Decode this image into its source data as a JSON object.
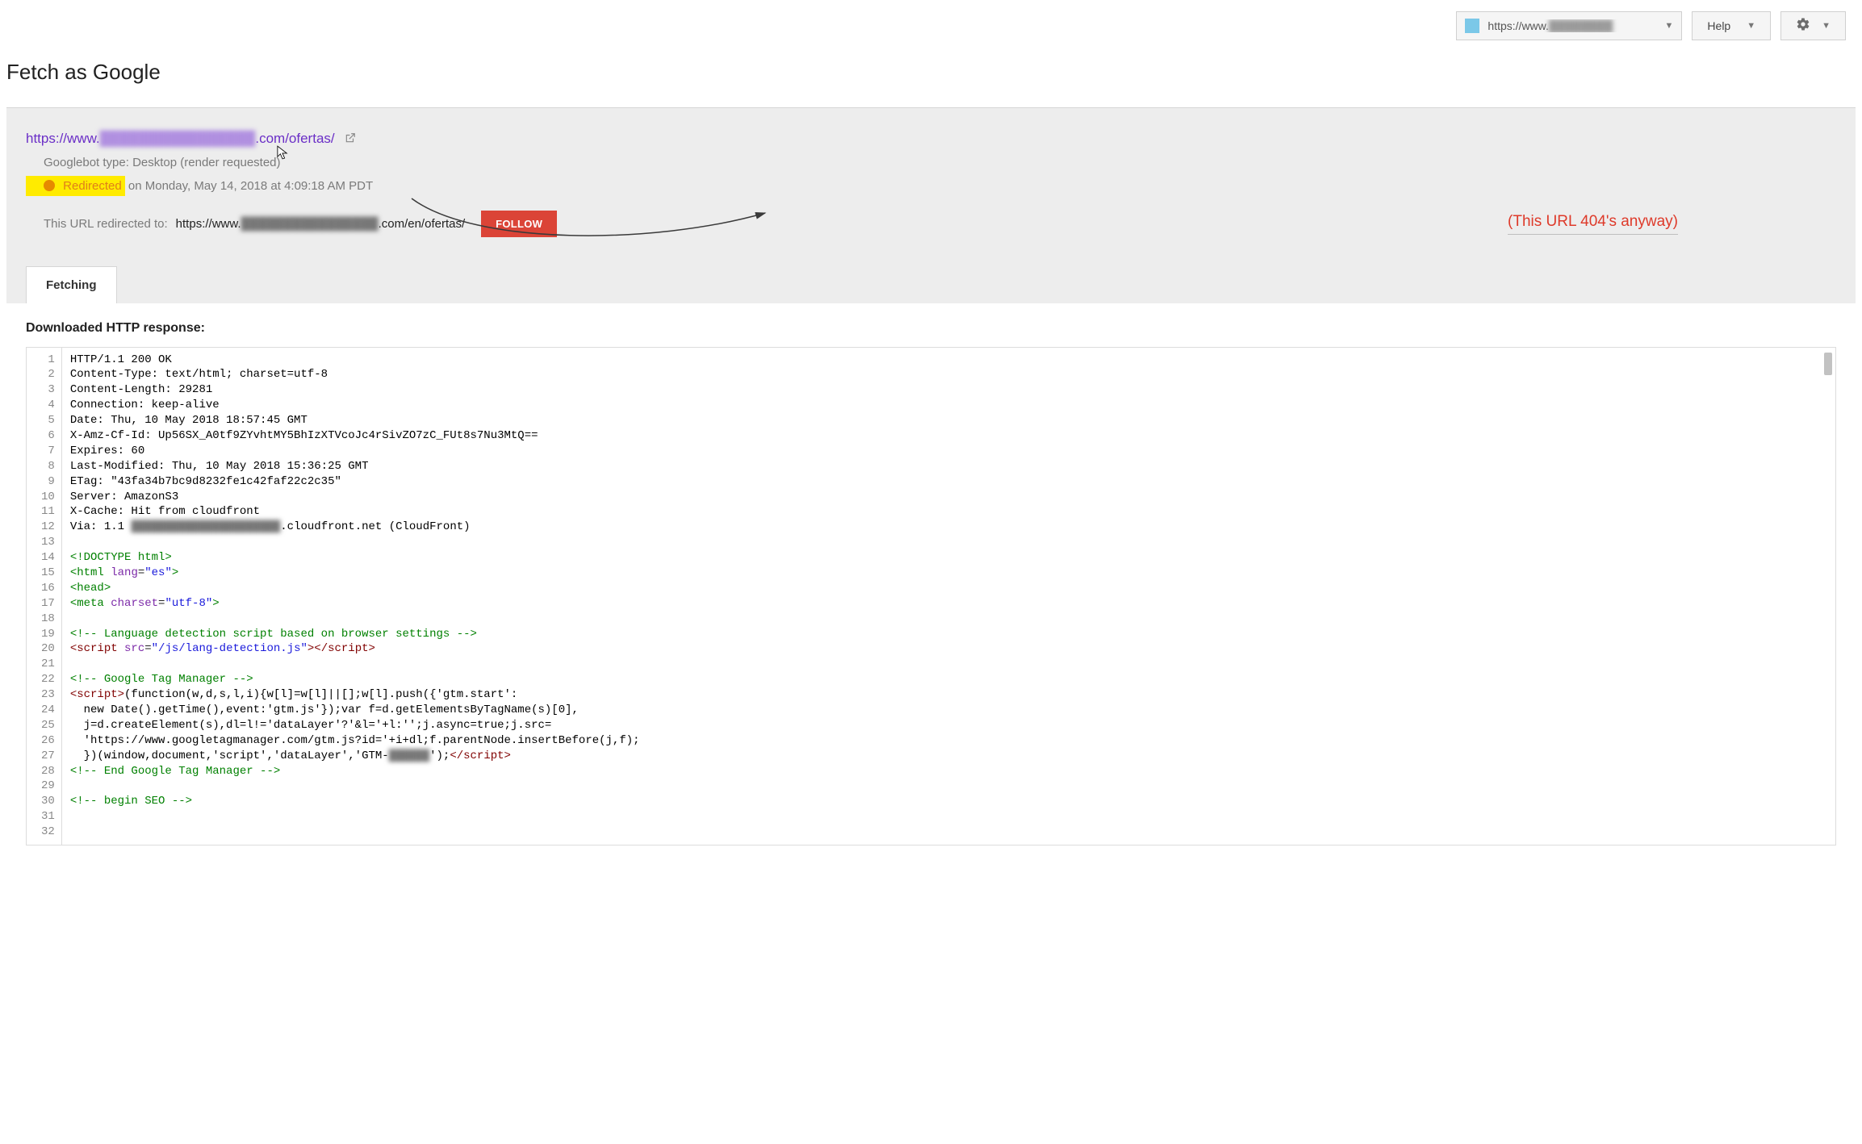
{
  "toolbar": {
    "site_url_prefix": "https://www.",
    "site_url_blur": "████████",
    "help_label": "Help"
  },
  "page_title": "Fetch as Google",
  "panel": {
    "url_prefix": "https://www.",
    "url_blur": "████████████████",
    "url_suffix": ".com/ofertas/",
    "googlebot_type": "Googlebot type: Desktop (render requested)",
    "status_word": "Redirected",
    "status_rest": " on Monday, May 14, 2018 at 4:09:18 AM PDT",
    "redirect_label": "This URL redirected to:",
    "redirect_prefix": "https://www.",
    "redirect_blur": "████████████████",
    "redirect_suffix": ".com/en/ofertas/",
    "follow_label": "FOLLOW",
    "annotation": "(This URL 404's anyway)",
    "tab_label": "Fetching"
  },
  "response": {
    "heading": "Downloaded HTTP response:",
    "lines": [
      {
        "n": 1,
        "t": "plain",
        "s": "HTTP/1.1 200 OK"
      },
      {
        "n": 2,
        "t": "plain",
        "s": "Content-Type: text/html; charset=utf-8"
      },
      {
        "n": 3,
        "t": "plain",
        "s": "Content-Length: 29281"
      },
      {
        "n": 4,
        "t": "plain",
        "s": "Connection: keep-alive"
      },
      {
        "n": 5,
        "t": "plain",
        "s": "Date: Thu, 10 May 2018 18:57:45 GMT"
      },
      {
        "n": 6,
        "t": "plain",
        "s": "X-Amz-Cf-Id: Up56SX_A0tf9ZYvhtMY5BhIzXTVcoJc4rSivZO7zC_FUt8s7Nu3MtQ=="
      },
      {
        "n": 7,
        "t": "plain",
        "s": "Expires: 60"
      },
      {
        "n": 8,
        "t": "plain",
        "s": "Last-Modified: Thu, 10 May 2018 15:36:25 GMT"
      },
      {
        "n": 9,
        "t": "plain",
        "s": "ETag: \"43fa34b7bc9d8232fe1c42faf22c2c35\""
      },
      {
        "n": 10,
        "t": "plain",
        "s": "Server: AmazonS3"
      },
      {
        "n": 11,
        "t": "plain",
        "s": "X-Cache: Hit from cloudfront"
      },
      {
        "n": 12,
        "t": "via",
        "prefix": "Via: 1.1 ",
        "blur": "██████████████████████",
        "suffix": ".cloudfront.net (CloudFront)"
      },
      {
        "n": 13,
        "t": "plain",
        "s": ""
      },
      {
        "n": 14,
        "t": "tag",
        "s": "<!DOCTYPE html>"
      },
      {
        "n": 15,
        "t": "html",
        "raw": "<html lang=\"es\">"
      },
      {
        "n": 16,
        "t": "tag",
        "s": "<head>"
      },
      {
        "n": 17,
        "t": "html",
        "raw": "<meta charset=\"utf-8\">"
      },
      {
        "n": 18,
        "t": "plain",
        "s": ""
      },
      {
        "n": 19,
        "t": "comment",
        "s": "<!-- Language detection script based on browser settings -->"
      },
      {
        "n": 20,
        "t": "html",
        "raw": "<script src=\"/js/lang-detection.js\"></script>"
      },
      {
        "n": 21,
        "t": "plain",
        "s": ""
      },
      {
        "n": 22,
        "t": "comment",
        "s": "<!-- Google Tag Manager -->"
      },
      {
        "n": 23,
        "t": "mixed",
        "parts": [
          {
            "c": "t-tag-script",
            "s": "<script>"
          },
          {
            "c": "t-plain",
            "s": "(function(w,d,s,l,i){w[l]=w[l]||[];w[l].push({'gtm.start':"
          }
        ]
      },
      {
        "n": 24,
        "t": "plain",
        "s": "  new Date().getTime(),event:'gtm.js'});var f=d.getElementsByTagName(s)[0],"
      },
      {
        "n": 25,
        "t": "plain",
        "s": "  j=d.createElement(s),dl=l!='dataLayer'?'&l='+l:'';j.async=true;j.src="
      },
      {
        "n": 26,
        "t": "plain",
        "s": "  'https://www.googletagmanager.com/gtm.js?id='+i+dl;f.parentNode.insertBefore(j,f);"
      },
      {
        "n": 27,
        "t": "gtm",
        "prefix": "  })(window,document,'script','dataLayer','GTM-",
        "blur": "██████",
        "suffix": "');",
        "close": "</script>"
      },
      {
        "n": 28,
        "t": "comment",
        "s": "<!-- End Google Tag Manager -->"
      },
      {
        "n": 29,
        "t": "plain",
        "s": ""
      },
      {
        "n": 30,
        "t": "comment",
        "s": "<!-- begin SEO -->"
      },
      {
        "n": 31,
        "t": "plain",
        "s": ""
      },
      {
        "n": 32,
        "t": "plain",
        "s": ""
      }
    ]
  }
}
